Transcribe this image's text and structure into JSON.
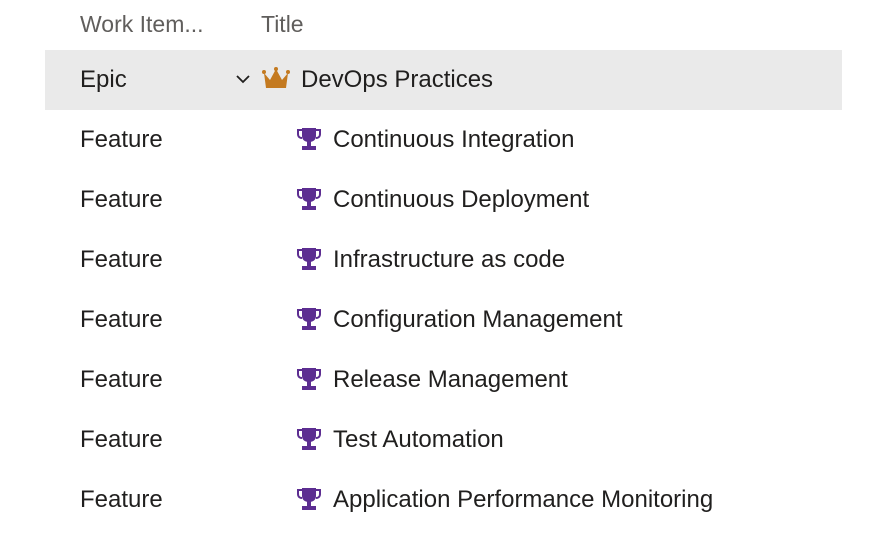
{
  "columns": {
    "type_header": "Work Item...",
    "title_header": "Title"
  },
  "colors": {
    "epic_icon": "#c47a20",
    "feature_icon": "#5c2d91",
    "selected_row_bg": "#eaeaea"
  },
  "rows": [
    {
      "type": "Epic",
      "title": "DevOps Practices",
      "icon": "crown-icon"
    },
    {
      "type": "Feature",
      "title": "Continuous Integration",
      "icon": "trophy-icon"
    },
    {
      "type": "Feature",
      "title": "Continuous Deployment",
      "icon": "trophy-icon"
    },
    {
      "type": "Feature",
      "title": "Infrastructure as code",
      "icon": "trophy-icon"
    },
    {
      "type": "Feature",
      "title": "Configuration Management",
      "icon": "trophy-icon"
    },
    {
      "type": "Feature",
      "title": "Release Management",
      "icon": "trophy-icon"
    },
    {
      "type": "Feature",
      "title": "Test Automation",
      "icon": "trophy-icon"
    },
    {
      "type": "Feature",
      "title": "Application Performance Monitoring",
      "icon": "trophy-icon"
    }
  ]
}
